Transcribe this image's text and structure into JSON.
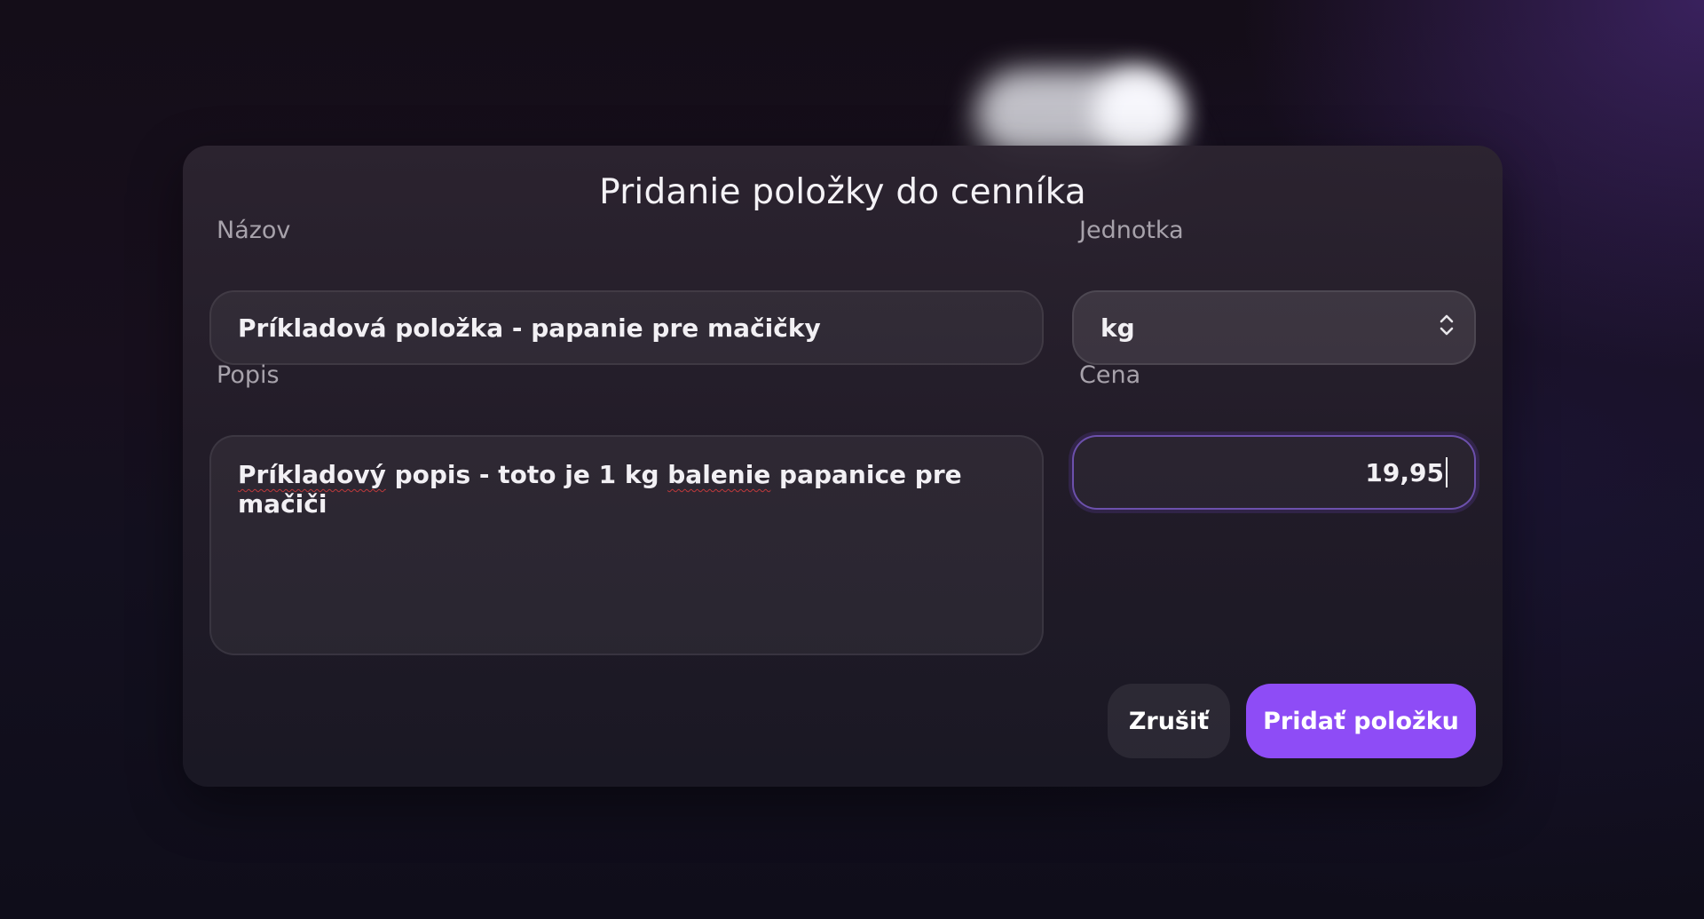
{
  "dialog": {
    "title": "Pridanie položky do cenníka"
  },
  "form": {
    "name": {
      "label": "Názov",
      "value": "Príkladová položka - papanie pre mačičky"
    },
    "unit": {
      "label": "Jednotka",
      "value": "kg"
    },
    "description": {
      "label": "Popis",
      "value_parts": [
        "Príkladový",
        " popis - toto je 1 kg ",
        "balenie",
        " papanice pre mačiči"
      ]
    },
    "price": {
      "label": "Cena",
      "value": "19,95"
    }
  },
  "actions": {
    "cancel_label": "Zrušiť",
    "submit_label": "Pridať položku"
  },
  "colors": {
    "accent": "#8e4cf6",
    "focus_border": "#9169f0",
    "spellcheck_underline": "#c0393b"
  },
  "icons": {
    "unit_select": "chevron-up-down-icon"
  }
}
